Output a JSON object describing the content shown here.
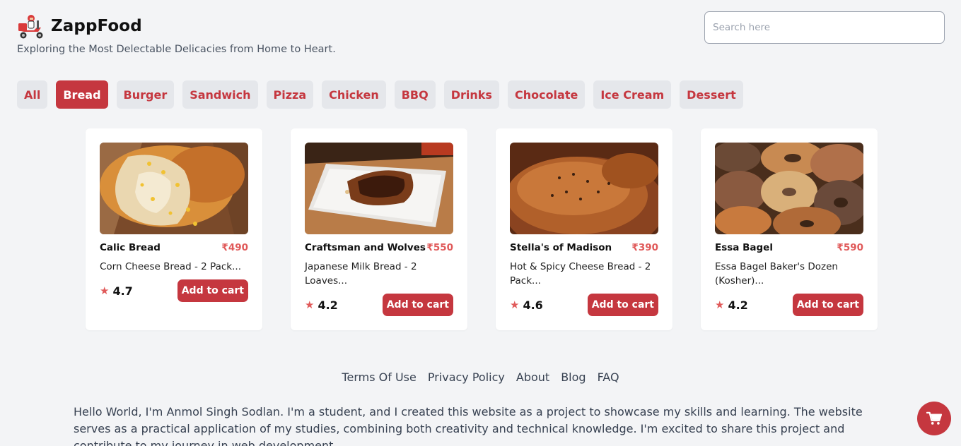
{
  "brand": {
    "name": "ZappFood",
    "tagline": "Exploring the Most Delectable Delicacies from Home to Heart."
  },
  "search": {
    "placeholder": "Search here",
    "value": ""
  },
  "categories": {
    "active": "Bread",
    "items": [
      "All",
      "Bread",
      "Burger",
      "Sandwich",
      "Pizza",
      "Chicken",
      "BBQ",
      "Drinks",
      "Chocolate",
      "Ice Cream",
      "Dessert"
    ]
  },
  "products": [
    {
      "name": "Calic Bread",
      "price": "₹490",
      "desc": "Corn Cheese Bread - 2 Pack...",
      "rating": "4.7",
      "button": "Add to cart"
    },
    {
      "name": "Craftsman and Wolves",
      "price": "₹550",
      "desc": "Japanese Milk Bread - 2 Loaves...",
      "rating": "4.2",
      "button": "Add to cart"
    },
    {
      "name": "Stella's of Madison",
      "price": "₹390",
      "desc": "Hot & Spicy Cheese Bread - 2 Pack...",
      "rating": "4.6",
      "button": "Add to cart"
    },
    {
      "name": "Essa Bagel",
      "price": "₹590",
      "desc": "Essa Bagel Baker's Dozen (Kosher)...",
      "rating": "4.2",
      "button": "Add to cart"
    }
  ],
  "footer": {
    "links": [
      "Terms Of Use",
      "Privacy Policy",
      "About",
      "Blog",
      "FAQ"
    ],
    "about": "Hello World, I'm Anmol Singh Sodlan. I'm a student, and I created this website as a project to showcase my skills and learning. The website serves as a practical application of my studies, combining both creativity and technical knowledge. I'm excited to share this project and contribute to my journey in web development."
  },
  "icons": {
    "logo": "delivery-scooter-icon",
    "star": "star-icon",
    "cart": "shopping-cart-icon"
  },
  "colors": {
    "accent": "#c5373f",
    "price": "#e05a5a",
    "background": "#f3f4f6"
  }
}
